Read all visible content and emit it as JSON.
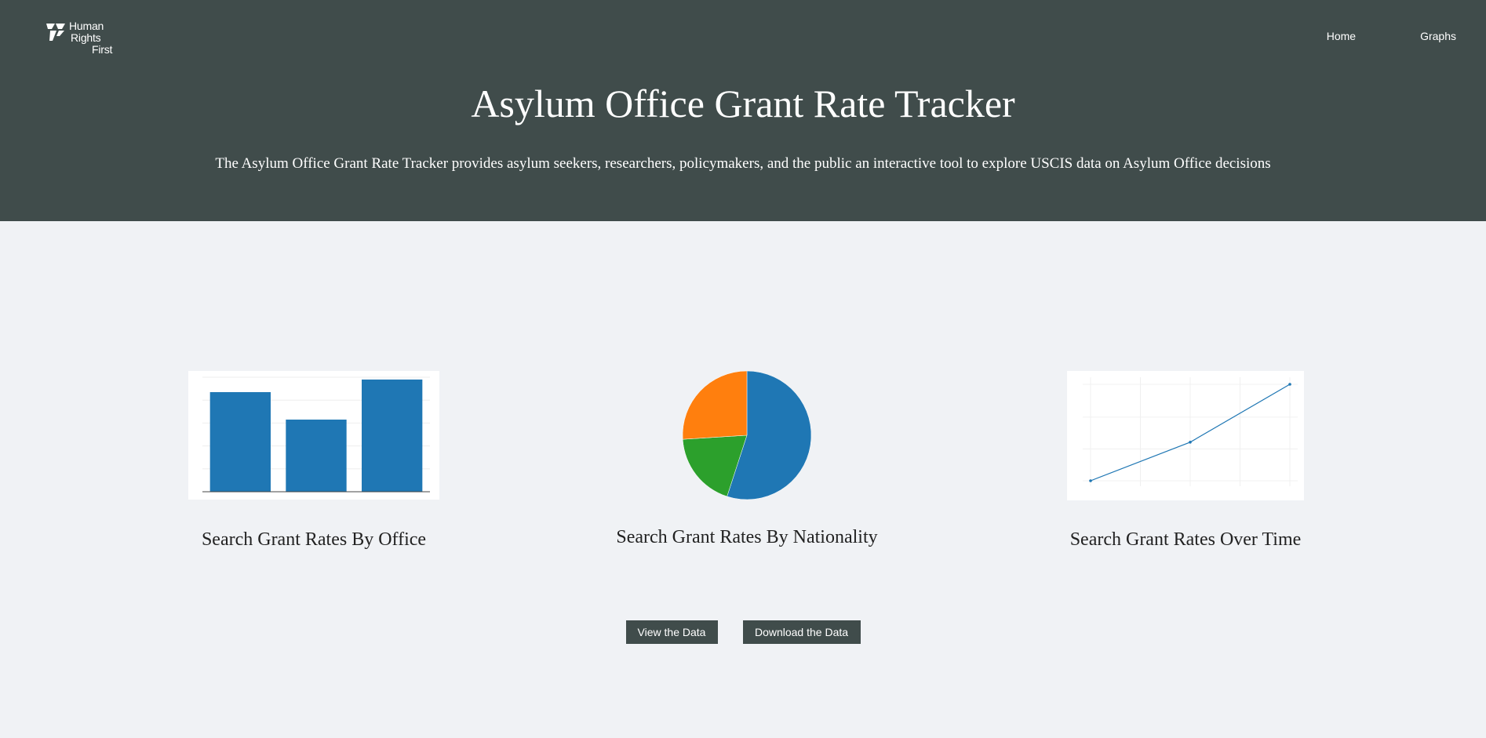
{
  "brand": {
    "logo_lines": [
      "Human",
      "Rights",
      "First"
    ],
    "header_bg": "#404c4b"
  },
  "nav": {
    "items": [
      {
        "label": "Home"
      },
      {
        "label": "Graphs"
      }
    ]
  },
  "hero": {
    "title": "Asylum Office Grant Rate Tracker",
    "subtitle": "The Asylum Office Grant Rate Tracker provides asylum seekers, researchers, policymakers, and the public an interactive tool to explore USCIS data on Asylum Office decisions"
  },
  "cards": {
    "office": {
      "label": "Search Grant Rates By Office"
    },
    "nationality": {
      "label": "Search Grant Rates By Nationality"
    },
    "time": {
      "label": "Search Grant Rates Over Time"
    }
  },
  "actions": {
    "view_label": "View the Data",
    "download_label": "Download the Data"
  },
  "chart_data": [
    {
      "type": "bar",
      "categories": [
        "",
        "",
        ""
      ],
      "values": [
        0.87,
        0.63,
        0.98
      ],
      "ylim": [
        0,
        1
      ],
      "grid": true,
      "colors": [
        "#1f77b4"
      ]
    },
    {
      "type": "pie",
      "values": [
        0.55,
        0.19,
        0.26
      ],
      "colors": [
        "#1f77b4",
        "#2ca02c",
        "#ff7f0e"
      ]
    },
    {
      "type": "line",
      "x": [
        0,
        1,
        2
      ],
      "values": [
        0.0,
        0.4,
        1.0
      ],
      "grid": true,
      "colors": [
        "#1f77b4"
      ]
    }
  ]
}
